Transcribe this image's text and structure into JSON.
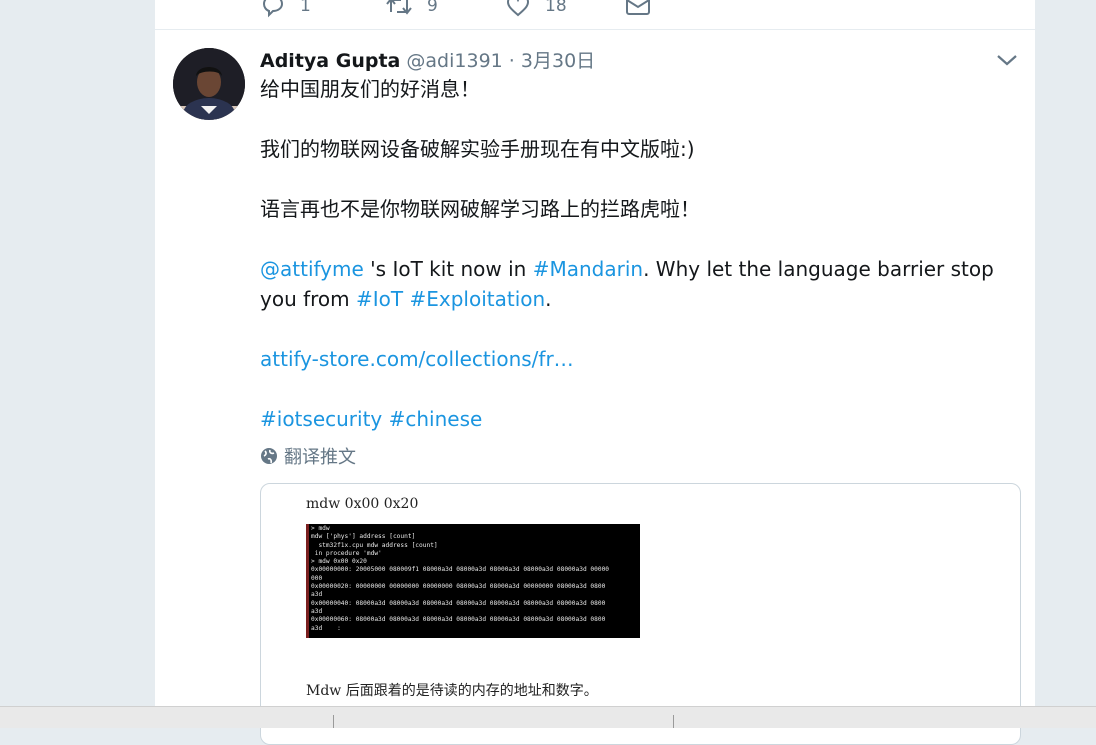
{
  "prev_tweet": {
    "reply_count": "1",
    "retweet_count": "9",
    "like_count": "18"
  },
  "tweet": {
    "author_name": "Aditya Gupta",
    "author_handle": "@adi1391",
    "dot": "·",
    "date": "3月30日",
    "line1": "给中国朋友们的好消息！",
    "line2": "我们的物联网设备破解实验手册现在有中文版啦:)",
    "line3": "语言再也不是你物联网破解学习路上的拦路虎啦！",
    "mention": "@attifyme",
    "text_a": " 's IoT kit now in ",
    "hashtag_mandarin": "#Mandarin",
    "text_b": ". Why let the language barrier stop you from ",
    "hashtag_iot": "#IoT",
    "text_space": " ",
    "hashtag_exploitation": "#Exploitation",
    "text_period": ".",
    "url": "attify-store.com/collections/fr…",
    "hashtag_iotsecurity": "#iotsecurity",
    "hashtag_chinese": "#chinese",
    "translate_label": "翻译推文"
  },
  "card": {
    "command": "mdw 0x00 0x20",
    "terminal_text": "> mdw\nmdw ['phys'] address [count]\n  stm32f1x.cpu mdw address [count]\n in procedure 'mdw'\n> mdw 0x00 0x20\n0x00000000: 20005000 080009f1 08000a3d 08000a3d 08000a3d 08000a3d 08000a3d 00000\n000\n0x00000020: 00000000 00000000 00000000 08000a3d 08000a3d 00000000 08000a3d 0800\na3d\n0x00000040: 08000a3d 08000a3d 08000a3d 08000a3d 08000a3d 08000a3d 08000a3d 0800\na3d\n0x00000060: 08000a3d 08000a3d 08000a3d 08000a3d 08000a3d 08000a3d 08000a3d 0800\na3d    :",
    "caption": "Mdw 后面跟着的是待读的内存的地址和数字。"
  },
  "colors": {
    "link": "#1b95e0",
    "muted": "#657786",
    "background": "#e6ecf0"
  }
}
